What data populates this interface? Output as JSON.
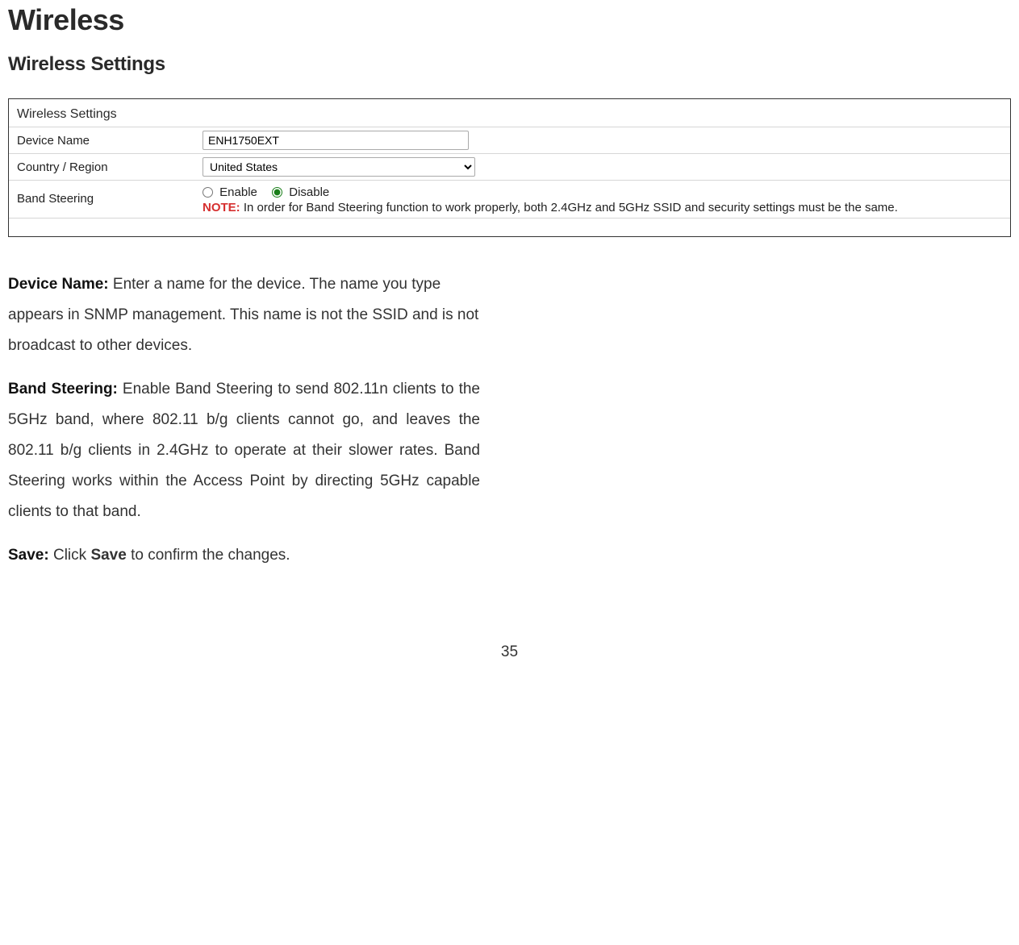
{
  "heading": "Wireless",
  "section_heading": "Wireless Settings",
  "panel": {
    "title": "Wireless Settings",
    "device_name_label": "Device Name",
    "device_name_value": "ENH1750EXT",
    "country_label": "Country / Region",
    "country_value": "United States",
    "band_steering_label": "Band Steering",
    "enable_label": "Enable",
    "disable_label": "Disable",
    "note_label": "NOTE:",
    "note_text": "In order for Band Steering function to work properly, both 2.4GHz and 5GHz SSID and security settings must be the same."
  },
  "descriptions": {
    "device_name_term": "Device Name:",
    "device_name_text": " Enter a name for the device. The name you type appears in SNMP management. This name is not the SSID and is not broadcast to other devices.",
    "band_steering_term": "Band Steering:",
    "band_steering_text": " Enable Band Steering to send 802.11n clients to the 5GHz band, where 802.11 b/g clients cannot go, and leaves the 802.11 b/g clients in 2.4GHz to operate at their slower rates. Band Steering works within the Access Point by directing 5GHz capable clients to that band.",
    "save_term": "Save:",
    "save_prefix": " Click ",
    "save_bold": "Save",
    "save_suffix": " to confirm the changes."
  },
  "page_number": "35"
}
